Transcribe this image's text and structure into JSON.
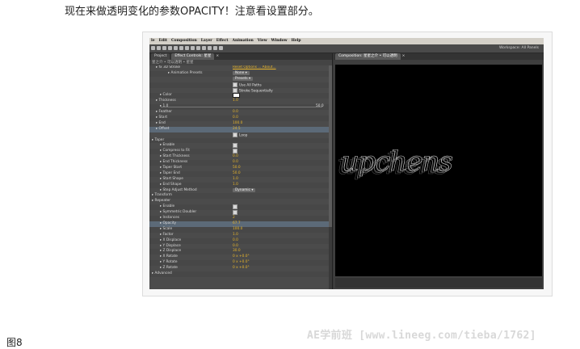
{
  "intro_text": "现在来做透明变化的参数OPACITY！注意看设置部分。",
  "figure_label": "图8",
  "watermark": "AE学前班    [www.lineeg.com/tieba/1762]",
  "menu": [
    "le",
    "Edit",
    "Composition",
    "Layer",
    "Effect",
    "Animation",
    "View",
    "Window",
    "Help"
  ],
  "workspace_label": "Workspace:  All Panels",
  "left_tabs": [
    "Project",
    "Effect Controls: 星星",
    "×"
  ],
  "left_crumb": "星之介 • 可以透明 • 星星",
  "right_tabs": [
    "Composition: 星星之介 • 可以透明",
    "×"
  ],
  "comp_text": "upchens",
  "effect_rows": [
    {
      "indent": 1,
      "label": "fx 3D Stroke",
      "value": "Reset  Options ...  About...",
      "kind": "link"
    },
    {
      "indent": 4,
      "label": "Animation Presets",
      "value": "None",
      "kind": "dropdown"
    },
    {
      "indent": 0,
      "label": "",
      "value": "Presets",
      "kind": "dropdown"
    },
    {
      "indent": 0,
      "label": "",
      "value": "Use All Paths",
      "kind": "check"
    },
    {
      "indent": 0,
      "label": "",
      "value": "Stroke Sequentially",
      "kind": "check"
    },
    {
      "indent": 2,
      "label": "Color",
      "value": "",
      "kind": "swatch"
    },
    {
      "indent": 1,
      "label": "Thickness",
      "value": "1.0",
      "kind": "num"
    },
    {
      "indent": 2,
      "label": "1.0",
      "value": "50.0",
      "kind": "slider"
    },
    {
      "indent": 1,
      "label": "Feather",
      "value": "0.0",
      "kind": "num"
    },
    {
      "indent": 1,
      "label": "Start",
      "value": "0.0",
      "kind": "num"
    },
    {
      "indent": 1,
      "label": "End",
      "value": "100.0",
      "kind": "num"
    },
    {
      "indent": 1,
      "label": "Offset",
      "value": "24.5",
      "kind": "num",
      "selected": true
    },
    {
      "indent": 1,
      "label": "",
      "value": "Loop",
      "kind": "check"
    },
    {
      "indent": 0,
      "label": "Taper",
      "value": "",
      "kind": "section"
    },
    {
      "indent": 2,
      "label": "Enable",
      "value": "",
      "kind": "check"
    },
    {
      "indent": 2,
      "label": "Compress to Fit",
      "value": "",
      "kind": "check"
    },
    {
      "indent": 2,
      "label": "Start Thickness",
      "value": "0.0",
      "kind": "num"
    },
    {
      "indent": 2,
      "label": "End Thickness",
      "value": "0.0",
      "kind": "num"
    },
    {
      "indent": 2,
      "label": "Taper Start",
      "value": "50.0",
      "kind": "num"
    },
    {
      "indent": 2,
      "label": "Taper End",
      "value": "50.0",
      "kind": "num"
    },
    {
      "indent": 2,
      "label": "Start Shape",
      "value": "1.0",
      "kind": "num"
    },
    {
      "indent": 2,
      "label": "End Shape",
      "value": "1.0",
      "kind": "num"
    },
    {
      "indent": 2,
      "label": "Step Adjust Method",
      "value": "Dynamic",
      "kind": "dropdown"
    },
    {
      "indent": 0,
      "label": "Transform",
      "value": "",
      "kind": "section"
    },
    {
      "indent": 0,
      "label": "Repeater",
      "value": "",
      "kind": "section"
    },
    {
      "indent": 2,
      "label": "Enable",
      "value": "",
      "kind": "check"
    },
    {
      "indent": 2,
      "label": "Symmetric Doubler",
      "value": "",
      "kind": "check"
    },
    {
      "indent": 2,
      "label": "Instances",
      "value": "2",
      "kind": "num"
    },
    {
      "indent": 2,
      "label": "Opacity",
      "value": "67.7",
      "kind": "num",
      "selected": true
    },
    {
      "indent": 2,
      "label": "Scale",
      "value": "100.0",
      "kind": "num"
    },
    {
      "indent": 2,
      "label": "Factor",
      "value": "1.0",
      "kind": "num"
    },
    {
      "indent": 2,
      "label": "X Displace",
      "value": "0.0",
      "kind": "num"
    },
    {
      "indent": 2,
      "label": "Y Displace",
      "value": "0.0",
      "kind": "num"
    },
    {
      "indent": 2,
      "label": "Z Displace",
      "value": "30.0",
      "kind": "num"
    },
    {
      "indent": 2,
      "label": "X Rotate",
      "value": "0 x +0.0°",
      "kind": "num"
    },
    {
      "indent": 2,
      "label": "Y Rotate",
      "value": "0 x +0.0°",
      "kind": "num"
    },
    {
      "indent": 2,
      "label": "Z Rotate",
      "value": "0 x +0.0°",
      "kind": "num"
    },
    {
      "indent": 0,
      "label": "Advanced",
      "value": "",
      "kind": "section"
    }
  ]
}
